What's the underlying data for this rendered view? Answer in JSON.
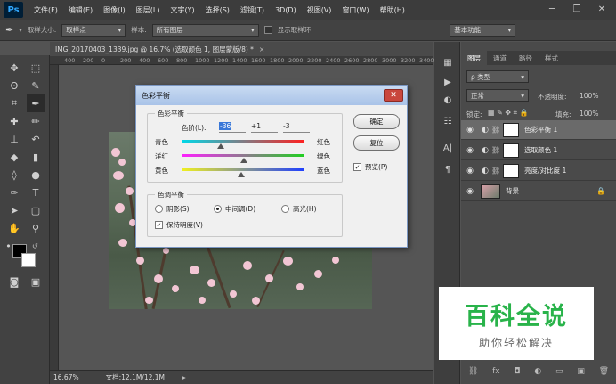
{
  "menubar": {
    "logo": "Ps",
    "items": [
      "文件(F)",
      "编辑(E)",
      "图像(I)",
      "图层(L)",
      "文字(Y)",
      "选择(S)",
      "滤镜(T)",
      "3D(D)",
      "视图(V)",
      "窗口(W)",
      "帮助(H)"
    ],
    "minimize": "─",
    "restore": "❐",
    "close": "✕"
  },
  "options": {
    "sample_size_label": "取样大小:",
    "sample_size_value": "取样点",
    "sample_label": "样本:",
    "sample_value": "所有图层",
    "show_ring_label": "显示取样环",
    "workspace": "基本功能"
  },
  "document": {
    "tab_title": "IMG_20170403_1339.jpg @ 16.7% (选取颜色 1, 图层蒙版/8) *",
    "tab_close": "×",
    "ruler_ticks": [
      "400",
      "200",
      "0",
      "200",
      "400",
      "600",
      "800",
      "1000",
      "1200",
      "1400",
      "1600",
      "1800",
      "2000",
      "2200",
      "2400",
      "2600",
      "2800",
      "3000",
      "3200",
      "3400"
    ],
    "zoom": "16.67%",
    "doc_info": "文档:12.1M/12.1M"
  },
  "dialog": {
    "title": "色彩平衡",
    "close": "✕",
    "color_balance_group": "色彩平衡",
    "levels_label": "色阶(L):",
    "level_values": [
      "-36",
      "+1",
      "-3"
    ],
    "rows": [
      {
        "left": "青色",
        "right": "红色",
        "value": -36
      },
      {
        "left": "洋红",
        "right": "绿色",
        "value": 1
      },
      {
        "left": "黄色",
        "right": "蓝色",
        "value": -3
      }
    ],
    "tone_group": "色调平衡",
    "tones": [
      {
        "label": "阴影(S)",
        "selected": false
      },
      {
        "label": "中间调(D)",
        "selected": true
      },
      {
        "label": "高光(H)",
        "selected": false
      }
    ],
    "preserve_label": "保持明度(V)",
    "preserve_checked": true,
    "ok_label": "确定",
    "reset_label": "复位",
    "preview_label": "预览(P)",
    "preview_checked": true
  },
  "panel": {
    "tabs": [
      "图层",
      "通道",
      "路径",
      "样式"
    ],
    "filter_placeholder": "ρ 类型",
    "blend_mode": "正常",
    "opacity_label": "不透明度:",
    "opacity_value": "100%",
    "lock_label": "锁定:",
    "fill_label": "填充:",
    "fill_value": "100%",
    "layers": [
      {
        "name": "色彩平衡 1",
        "selected": true
      },
      {
        "name": "选取颜色 1",
        "selected": false
      },
      {
        "name": "亮度/对比度 1",
        "selected": false
      },
      {
        "name": "背景",
        "selected": false
      }
    ]
  },
  "watermark": {
    "title": "百科全说",
    "subtitle": "助你轻松解决"
  },
  "colors": {
    "accent": "#31a8ff",
    "watermark_green": "#29b34a"
  }
}
